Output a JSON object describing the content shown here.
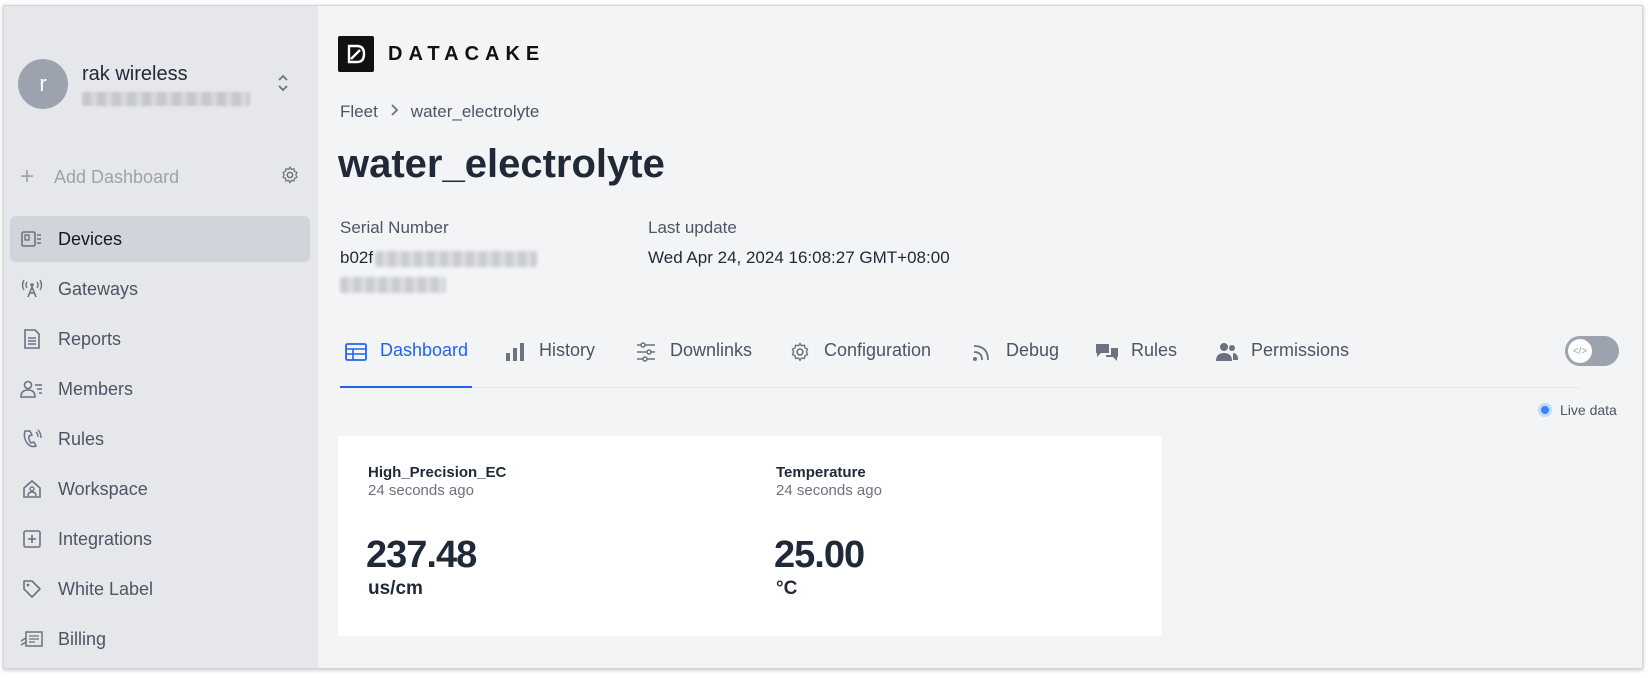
{
  "workspace": {
    "avatar_letter": "r",
    "name": "rak wireless"
  },
  "sidebar": {
    "add_dashboard": "Add Dashboard",
    "items": [
      {
        "label": "Devices",
        "icon": "devices-icon",
        "active": true
      },
      {
        "label": "Gateways",
        "icon": "gateway-icon"
      },
      {
        "label": "Reports",
        "icon": "report-icon"
      },
      {
        "label": "Members",
        "icon": "members-icon"
      },
      {
        "label": "Rules",
        "icon": "rules-icon"
      },
      {
        "label": "Workspace",
        "icon": "workspace-icon"
      },
      {
        "label": "Integrations",
        "icon": "integrations-icon"
      },
      {
        "label": "White Label",
        "icon": "tag-icon"
      },
      {
        "label": "Billing",
        "icon": "billing-icon"
      }
    ]
  },
  "header": {
    "logo_text": "DATACAKE",
    "breadcrumb": [
      "Fleet",
      "water_electrolyte"
    ],
    "title": "water_electrolyte"
  },
  "device": {
    "serial_label": "Serial Number",
    "serial_value_visible": "b02f",
    "last_update_label": "Last update",
    "last_update_value": "Wed Apr 24, 2024 16:08:27 GMT+08:00"
  },
  "tabs": [
    {
      "label": "Dashboard",
      "icon": "table-icon",
      "active": true
    },
    {
      "label": "History",
      "icon": "bar-chart-icon"
    },
    {
      "label": "Downlinks",
      "icon": "sliders-icon"
    },
    {
      "label": "Configuration",
      "icon": "gear-icon"
    },
    {
      "label": "Debug",
      "icon": "rss-icon"
    },
    {
      "label": "Rules",
      "icon": "comments-icon"
    },
    {
      "label": "Permissions",
      "icon": "users-icon"
    }
  ],
  "live_data_label": "Live data",
  "widgets": [
    {
      "name": "High_Precision_EC",
      "time": "24 seconds ago",
      "value": "237.48",
      "unit": "us/cm"
    },
    {
      "name": "Temperature",
      "time": "24 seconds ago",
      "value": "25.00",
      "unit": "°C"
    }
  ],
  "colors": {
    "accent": "#2563eb",
    "sidebar_bg": "#e5e7eb",
    "page_bg": "#f3f4f6"
  }
}
